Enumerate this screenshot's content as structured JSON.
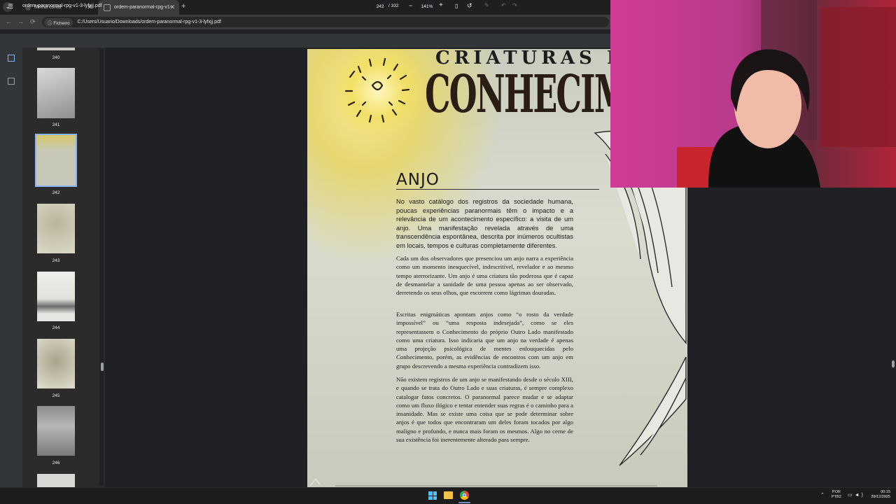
{
  "browser": {
    "tabs": [
      {
        "label": "Minha conta",
        "active": false
      },
      {
        "label": "ordem-paranormal-rpg-v1-3-lyfxjj.pdf",
        "active": true
      }
    ],
    "new_tab": "+",
    "url_chip": "Ficheiro",
    "url": "C:/Users/Usuario/Downloads/ordem-paranormal-rpg-v1-3-lyfxjj.pdf"
  },
  "pdf_toolbar": {
    "title": "ordem-paranormal-rpg-v1-3-lyfxjj.pdf",
    "current_page": "242",
    "total_pages": "/ 332",
    "zoom": "141%"
  },
  "thumbnails": [
    {
      "label": "240"
    },
    {
      "label": "241"
    },
    {
      "label": "242",
      "selected": true
    },
    {
      "label": "243"
    },
    {
      "label": "244"
    },
    {
      "label": "245"
    },
    {
      "label": "246"
    }
  ],
  "page": {
    "title_line1": "CRIATURAS DE",
    "title_line2": "CONHECIMENT",
    "heading": "ANJO",
    "para1": "No vasto catálogo dos registros da sociedade humana, poucas experiências paranormais têm o impacto e a relevância de um acontecimento específico: a visita de um anjo. Uma manifestação revelada através de uma transcendência espontânea, descrita por inúmeros ocultistas em locais, tempos e culturas completamente diferentes.",
    "para2": "Cada um dos observadores que presenciou um anjo narra a experiência como um momento inesquecível, indescritível, revelador e ao mesmo tempo aterrorizante. Um anjo é uma criatura tão poderosa que é capaz de desmantelar a sanidade de uma pessoa apenas ao ser observado, derretendo os seus olhos, que escorrem como lágrimas douradas.",
    "para3": "Escritas enigmáticas apontam anjos como “o rosto da verdade impossível” ou “uma resposta indesejada”, como se eles representassem o Conhecimento do próprio Outro Lado manifestado como uma criatura. Isso indicaria que um anjo na verdade é apenas uma projeção psicológica de mentes enlouquecidas pelo Conhecimento, porém, as evidências de encontros com um anjo em grupo descrevendo a mesma experiência contradizem isso.",
    "para4": "Não existem registros de um anjo se manifestando desde o século XIII, e quando se trata do Outro Lado e suas criaturas, é sempre complexo catalogar fatos concretos. O paranormal parece mudar e se adaptar como um fluxo ilógico e tentar entender suas regras é o caminho para a insanidade. Mas se existe uma coisa que se pode determinar sobre anjos é que todos que encontraram um deles foram tocados por algo maligno e profundo, e nunca mais foram os mesmos. Algo no cerne de sua existência foi inerentemente alterado para sempre."
  },
  "taskbar": {
    "lang_line1": "POR",
    "lang_line2": "PTB2",
    "time": "00:15",
    "date": "28/12/2025"
  },
  "colors": {
    "accent": "#8ab4f8",
    "page_bg": "#cfd2c6",
    "sun": "#f3df6c",
    "webcam_bg": "#c03c8c"
  }
}
